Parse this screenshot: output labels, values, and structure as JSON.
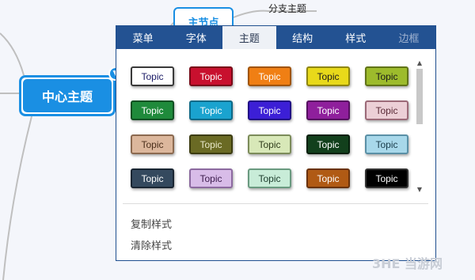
{
  "mindmap": {
    "central_topic": "中心主题",
    "main_topic": "主节点",
    "branch_topic": "分支主题"
  },
  "panel": {
    "tabs": [
      {
        "label": "菜单",
        "state": "normal"
      },
      {
        "label": "字体",
        "state": "normal"
      },
      {
        "label": "主题",
        "state": "active"
      },
      {
        "label": "结构",
        "state": "normal"
      },
      {
        "label": "样式",
        "state": "normal"
      },
      {
        "label": "边框",
        "state": "disabled"
      }
    ],
    "swatch_rows": [
      [
        {
          "text": "Topic",
          "bg": "#ffffff",
          "fg": "#1a1a66",
          "border": "#3a3a3a"
        },
        {
          "text": "Topic",
          "bg": "#c8102e",
          "fg": "#ffffff",
          "border": "#7a0a18"
        },
        {
          "text": "Topic",
          "bg": "#f07f14",
          "fg": "#ffffff",
          "border": "#a15408"
        },
        {
          "text": "Topic",
          "bg": "#e8d91a",
          "fg": "#1a1a1a",
          "border": "#8f860c"
        },
        {
          "text": "Topic",
          "bg": "#9dbb2c",
          "fg": "#1a1a1a",
          "border": "#617417"
        }
      ],
      [
        {
          "text": "Topic",
          "bg": "#1f8a3b",
          "fg": "#ffffff",
          "border": "#105022"
        },
        {
          "text": "Topic",
          "bg": "#1aa3cf",
          "fg": "#ffffff",
          "border": "#0e6a88"
        },
        {
          "text": "Topic",
          "bg": "#3c1fd6",
          "fg": "#ffffff",
          "border": "#211187"
        },
        {
          "text": "Topic",
          "bg": "#8f1f9c",
          "fg": "#ffffff",
          "border": "#561060"
        },
        {
          "text": "Topic",
          "bg": "#eccfd6",
          "fg": "#5a2a36",
          "border": "#9c6a78"
        }
      ],
      [
        {
          "text": "Topic",
          "bg": "#dcb79c",
          "fg": "#4a2e1a",
          "border": "#8c6a50"
        },
        {
          "text": "Topic",
          "bg": "#6a6a24",
          "fg": "#eaeacb",
          "border": "#3c3c10"
        },
        {
          "text": "Topic",
          "bg": "#d8e8b8",
          "fg": "#2e3a1a",
          "border": "#7c8c5a"
        },
        {
          "text": "Topic",
          "bg": "#12401c",
          "fg": "#ffffff",
          "border": "#061f0c"
        },
        {
          "text": "Topic",
          "bg": "#a8d8ea",
          "fg": "#1a3c4a",
          "border": "#5a90a6"
        }
      ],
      [
        {
          "text": "Topic",
          "bg": "#34495e",
          "fg": "#ffffff",
          "border": "#1a2633"
        },
        {
          "text": "Topic",
          "bg": "#d8bce8",
          "fg": "#3a1a4a",
          "border": "#8c6aa0"
        },
        {
          "text": "Topic",
          "bg": "#c8ecd8",
          "fg": "#1a3a2a",
          "border": "#6a9a80"
        },
        {
          "text": "Topic",
          "bg": "#b05a14",
          "fg": "#ffffff",
          "border": "#6a320a"
        },
        {
          "text": "Topic",
          "bg": "#000000",
          "fg": "#ffffff",
          "border": "#333333"
        }
      ]
    ],
    "actions": {
      "copy_style": "复制样式",
      "clear_style": "清除样式"
    }
  },
  "watermark": "3HE 当游网"
}
